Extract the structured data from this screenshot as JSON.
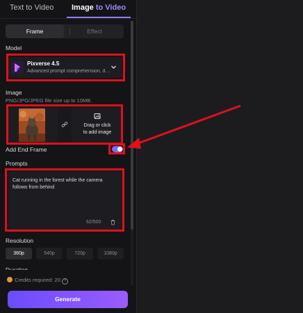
{
  "tabs": {
    "text_to_video": "Text to Video",
    "image_to_video_prefix": "Image ",
    "image_to_video_accent": "to Video"
  },
  "segmented": {
    "frame": "Frame",
    "effect": "Effect"
  },
  "model": {
    "label": "Model",
    "name": "Pixverse 4.5",
    "description": "Advanced prompt comprehension, diverse motion effects"
  },
  "image": {
    "label": "Image",
    "hint": "PNG/JPG/JPEG file size up to 10MB.",
    "upload_line1": "Drag or click",
    "upload_line2": "to add image"
  },
  "end_frame": {
    "label": "Add End Frame",
    "enabled": true
  },
  "prompts": {
    "label": "Prompts",
    "text": "Cat running in the forest while the camera follows from behind",
    "count": "62/500"
  },
  "resolution": {
    "label": "Resolution",
    "options": [
      "360p",
      "540p",
      "720p",
      "1080p"
    ],
    "selected": "360p"
  },
  "duration": {
    "label": "Duration"
  },
  "credits": {
    "text": "Credits required: 20"
  },
  "generate": {
    "label": "Generate"
  },
  "colors": {
    "accent": "#8f7cff",
    "highlight": "#e0101c",
    "button_start": "#6a4cff",
    "button_end": "#9b5cff"
  },
  "icons": [
    "pixverse-logo",
    "chevron-down-icon",
    "link-icon",
    "image-add-icon",
    "trash-icon",
    "coin-icon",
    "help-icon"
  ]
}
